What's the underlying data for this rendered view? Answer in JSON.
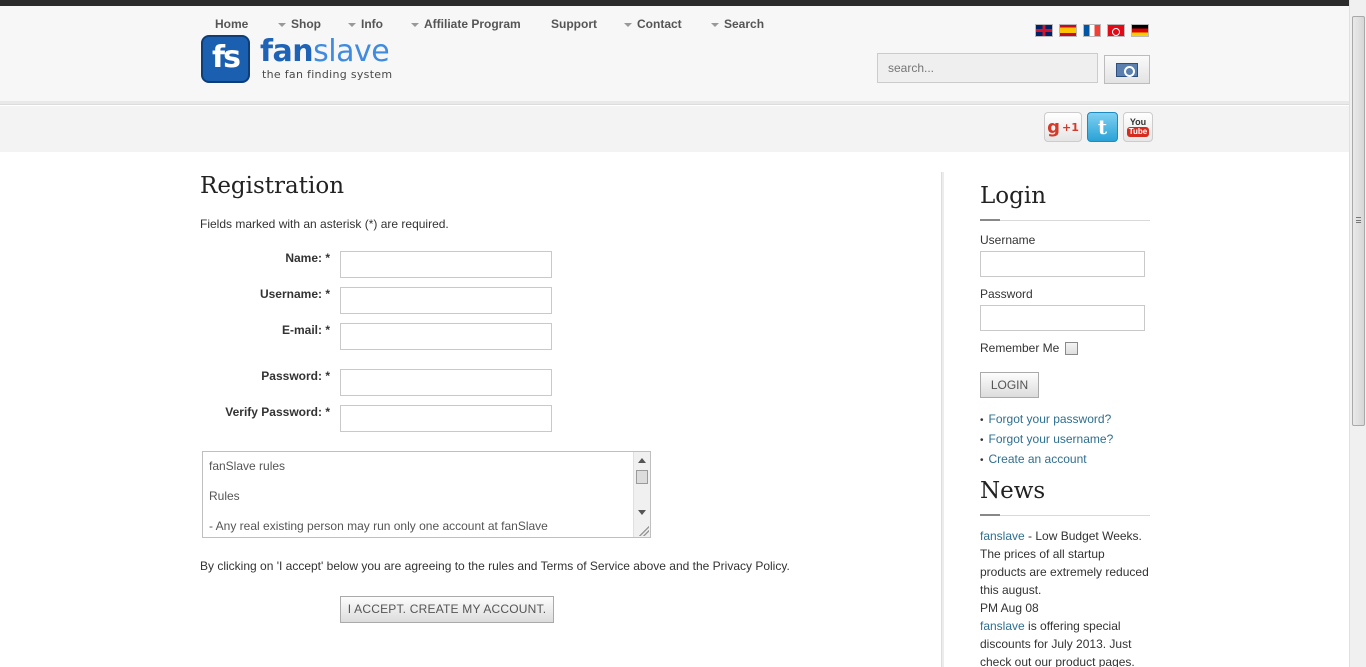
{
  "header": {
    "logo": {
      "mark": "fs",
      "name_a": "fan",
      "name_b": "slave",
      "tagline": "the fan finding system"
    },
    "flags": [
      "flag-uk-icon",
      "flag-es-icon",
      "flag-fr-icon",
      "flag-tr-icon",
      "flag-de-icon"
    ],
    "search": {
      "placeholder": "search...",
      "button_icon": "search-icon"
    }
  },
  "nav": {
    "items": [
      {
        "label": "Home",
        "dropdown": false
      },
      {
        "label": "Shop",
        "dropdown": true
      },
      {
        "label": "Info",
        "dropdown": true
      },
      {
        "label": "Affiliate Program",
        "dropdown": true
      },
      {
        "label": "Support",
        "dropdown": false
      },
      {
        "label": "Contact",
        "dropdown": true
      },
      {
        "label": "Search",
        "dropdown": true
      }
    ],
    "social": {
      "gplus": "+1",
      "gplus_g": "g",
      "twitter": "t",
      "youtube_top": "You",
      "youtube_bot": "Tube"
    }
  },
  "registration": {
    "title": "Registration",
    "note": "Fields marked with an asterisk (*) are required.",
    "fields": [
      {
        "label": "Name: *",
        "value": ""
      },
      {
        "label": "Username: *",
        "value": ""
      },
      {
        "label": "E-mail: *",
        "value": ""
      },
      {
        "label": "Password: *",
        "value": ""
      },
      {
        "label": "Verify Password: *",
        "value": ""
      }
    ],
    "rules_text": [
      "fanSlave rules",
      "Rules",
      "-   Any real existing person may run only one account at fanSlave"
    ],
    "agree_text": "By clicking on 'I accept' below you are agreeing to the rules and Terms of Service above and the Privacy Policy.",
    "accept_button": "I ACCEPT. CREATE MY ACCOUNT."
  },
  "sidebar": {
    "login_title": "Login",
    "username_label": "Username",
    "password_label": "Password",
    "remember_label": "Remember Me",
    "login_button": "LOGIN",
    "links": [
      "Forgot your password?",
      "Forgot your username?",
      "Create an account"
    ],
    "news_title": "News",
    "news": [
      {
        "link": "fanslave",
        "text": " - Low Budget Weeks. The prices of all startup products are extremely reduced this august."
      },
      {
        "date": "PM Aug 08"
      },
      {
        "link": "fanslave",
        "text": " is offering special discounts for July 2013. Just check out our product pages."
      }
    ]
  }
}
